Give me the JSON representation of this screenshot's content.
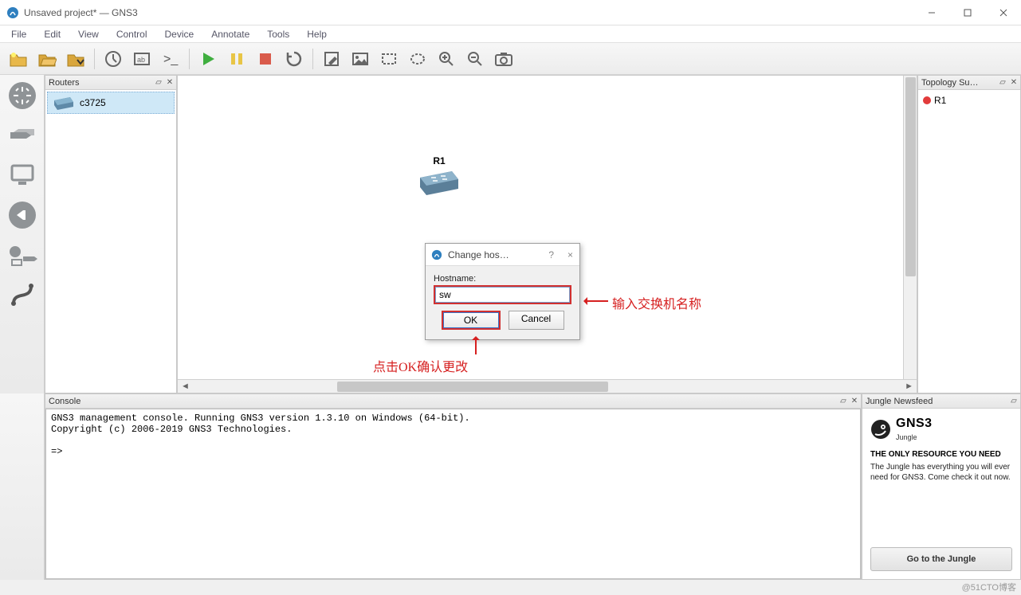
{
  "window": {
    "title": "Unsaved project* — GNS3"
  },
  "menu": {
    "file": "File",
    "edit": "Edit",
    "view": "View",
    "control": "Control",
    "device": "Device",
    "annotate": "Annotate",
    "tools": "Tools",
    "help": "Help"
  },
  "panels": {
    "routers": {
      "title": "Routers",
      "items": [
        "c3725"
      ]
    },
    "topology": {
      "title": "Topology Su…",
      "items": [
        {
          "name": "R1",
          "status": "stopped"
        }
      ]
    },
    "console": {
      "title": "Console",
      "line1": "GNS3 management console. Running GNS3 version 1.3.10 on Windows (64-bit).",
      "line2": "Copyright (c) 2006-2019 GNS3 Technologies.",
      "prompt": "=>"
    },
    "jungle": {
      "title": "Jungle Newsfeed",
      "logo_top": "GNS3",
      "logo_sub": "Jungle",
      "heading": "THE ONLY RESOURCE YOU NEED",
      "text": "The Jungle has everything you will ever need for GNS3. Come check it out now.",
      "button": "Go to the Jungle"
    }
  },
  "canvas": {
    "device_label": "R1"
  },
  "dialog": {
    "title": "Change hos…",
    "help": "?",
    "close": "×",
    "label": "Hostname:",
    "value": "sw",
    "ok": "OK",
    "cancel": "Cancel"
  },
  "annotations": {
    "input_hint": "输入交换机名称",
    "ok_hint": "点击OK确认更改"
  },
  "watermark": "@51CTO博客"
}
